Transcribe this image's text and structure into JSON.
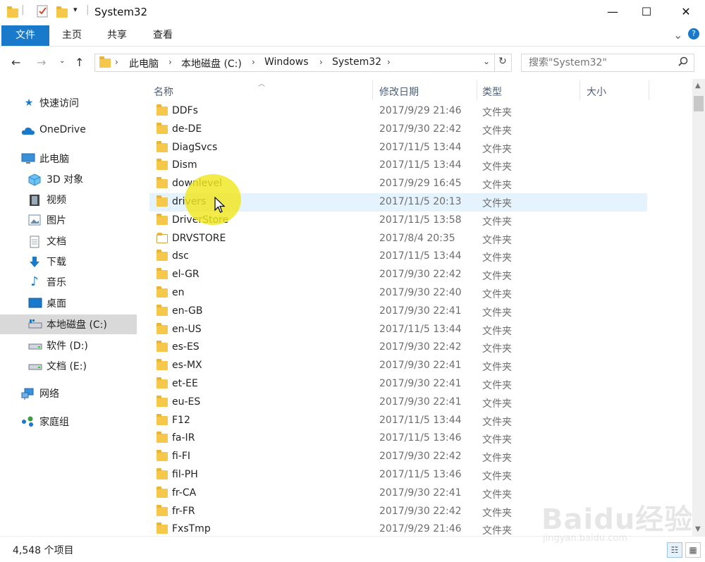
{
  "window": {
    "title": "System32",
    "minimize_glyph": "—",
    "maximize_glyph": "☐",
    "close_glyph": "✕"
  },
  "ribbon": {
    "tabs": [
      "文件",
      "主页",
      "共享",
      "查看"
    ],
    "expand_glyph": "⌄",
    "help_glyph": "?"
  },
  "address": {
    "breadcrumbs": [
      "此电脑",
      "本地磁盘 (C:)",
      "Windows",
      "System32"
    ],
    "search_placeholder": "搜索\"System32\""
  },
  "sidebar": {
    "items": [
      {
        "label": "快速访问",
        "icon": "star-icon"
      },
      {
        "label": "OneDrive",
        "icon": "cloud-icon"
      },
      {
        "label": "此电脑",
        "icon": "computer-icon"
      },
      {
        "label": "3D 对象",
        "icon": "cube-icon"
      },
      {
        "label": "视频",
        "icon": "film-icon"
      },
      {
        "label": "图片",
        "icon": "picture-icon"
      },
      {
        "label": "文档",
        "icon": "document-icon"
      },
      {
        "label": "下载",
        "icon": "download-icon"
      },
      {
        "label": "音乐",
        "icon": "music-icon"
      },
      {
        "label": "桌面",
        "icon": "desktop-icon"
      },
      {
        "label": "本地磁盘 (C:)",
        "icon": "drive-icon",
        "selected": true
      },
      {
        "label": "软件 (D:)",
        "icon": "drive-icon"
      },
      {
        "label": "文档 (E:)",
        "icon": "drive-icon"
      },
      {
        "label": "网络",
        "icon": "network-icon"
      },
      {
        "label": "家庭组",
        "icon": "homegroup-icon"
      }
    ]
  },
  "columns": {
    "name": "名称",
    "date": "修改日期",
    "type": "类型",
    "size": "大小"
  },
  "files": [
    {
      "name": "DDFs",
      "date": "2017/9/29 21:46",
      "type": "文件夹"
    },
    {
      "name": "de-DE",
      "date": "2017/9/30 22:42",
      "type": "文件夹"
    },
    {
      "name": "DiagSvcs",
      "date": "2017/11/5 13:44",
      "type": "文件夹"
    },
    {
      "name": "Dism",
      "date": "2017/11/5 13:44",
      "type": "文件夹"
    },
    {
      "name": "downlevel",
      "date": "2017/9/29 16:45",
      "type": "文件夹"
    },
    {
      "name": "drivers",
      "date": "2017/11/5 20:13",
      "type": "文件夹",
      "hover": true
    },
    {
      "name": "DriverStore",
      "date": "2017/11/5 13:58",
      "type": "文件夹"
    },
    {
      "name": "DRVSTORE",
      "date": "2017/8/4 20:35",
      "type": "文件夹",
      "special": true
    },
    {
      "name": "dsc",
      "date": "2017/11/5 13:44",
      "type": "文件夹"
    },
    {
      "name": "el-GR",
      "date": "2017/9/30 22:42",
      "type": "文件夹"
    },
    {
      "name": "en",
      "date": "2017/9/30 22:40",
      "type": "文件夹"
    },
    {
      "name": "en-GB",
      "date": "2017/9/30 22:41",
      "type": "文件夹"
    },
    {
      "name": "en-US",
      "date": "2017/11/5 13:44",
      "type": "文件夹"
    },
    {
      "name": "es-ES",
      "date": "2017/9/30 22:42",
      "type": "文件夹"
    },
    {
      "name": "es-MX",
      "date": "2017/9/30 22:41",
      "type": "文件夹"
    },
    {
      "name": "et-EE",
      "date": "2017/9/30 22:41",
      "type": "文件夹"
    },
    {
      "name": "eu-ES",
      "date": "2017/9/30 22:41",
      "type": "文件夹"
    },
    {
      "name": "F12",
      "date": "2017/11/5 13:44",
      "type": "文件夹"
    },
    {
      "name": "fa-IR",
      "date": "2017/11/5 13:46",
      "type": "文件夹"
    },
    {
      "name": "fi-FI",
      "date": "2017/9/30 22:42",
      "type": "文件夹"
    },
    {
      "name": "fil-PH",
      "date": "2017/11/5 13:46",
      "type": "文件夹"
    },
    {
      "name": "fr-CA",
      "date": "2017/9/30 22:41",
      "type": "文件夹"
    },
    {
      "name": "fr-FR",
      "date": "2017/9/30 22:42",
      "type": "文件夹"
    },
    {
      "name": "FxsTmp",
      "date": "2017/9/29 21:46",
      "type": "文件夹"
    }
  ],
  "status": {
    "item_count": "4,548 个项目"
  },
  "watermark": {
    "brand": "Baidu经验",
    "url": "jingyan.baidu.com"
  },
  "colors": {
    "accent": "#1979ca",
    "folder": "#f5c84c",
    "hover_row": "#e5f3ff",
    "selected_nav": "#d9d9d9",
    "cursor_highlight": "#f0e61e"
  }
}
